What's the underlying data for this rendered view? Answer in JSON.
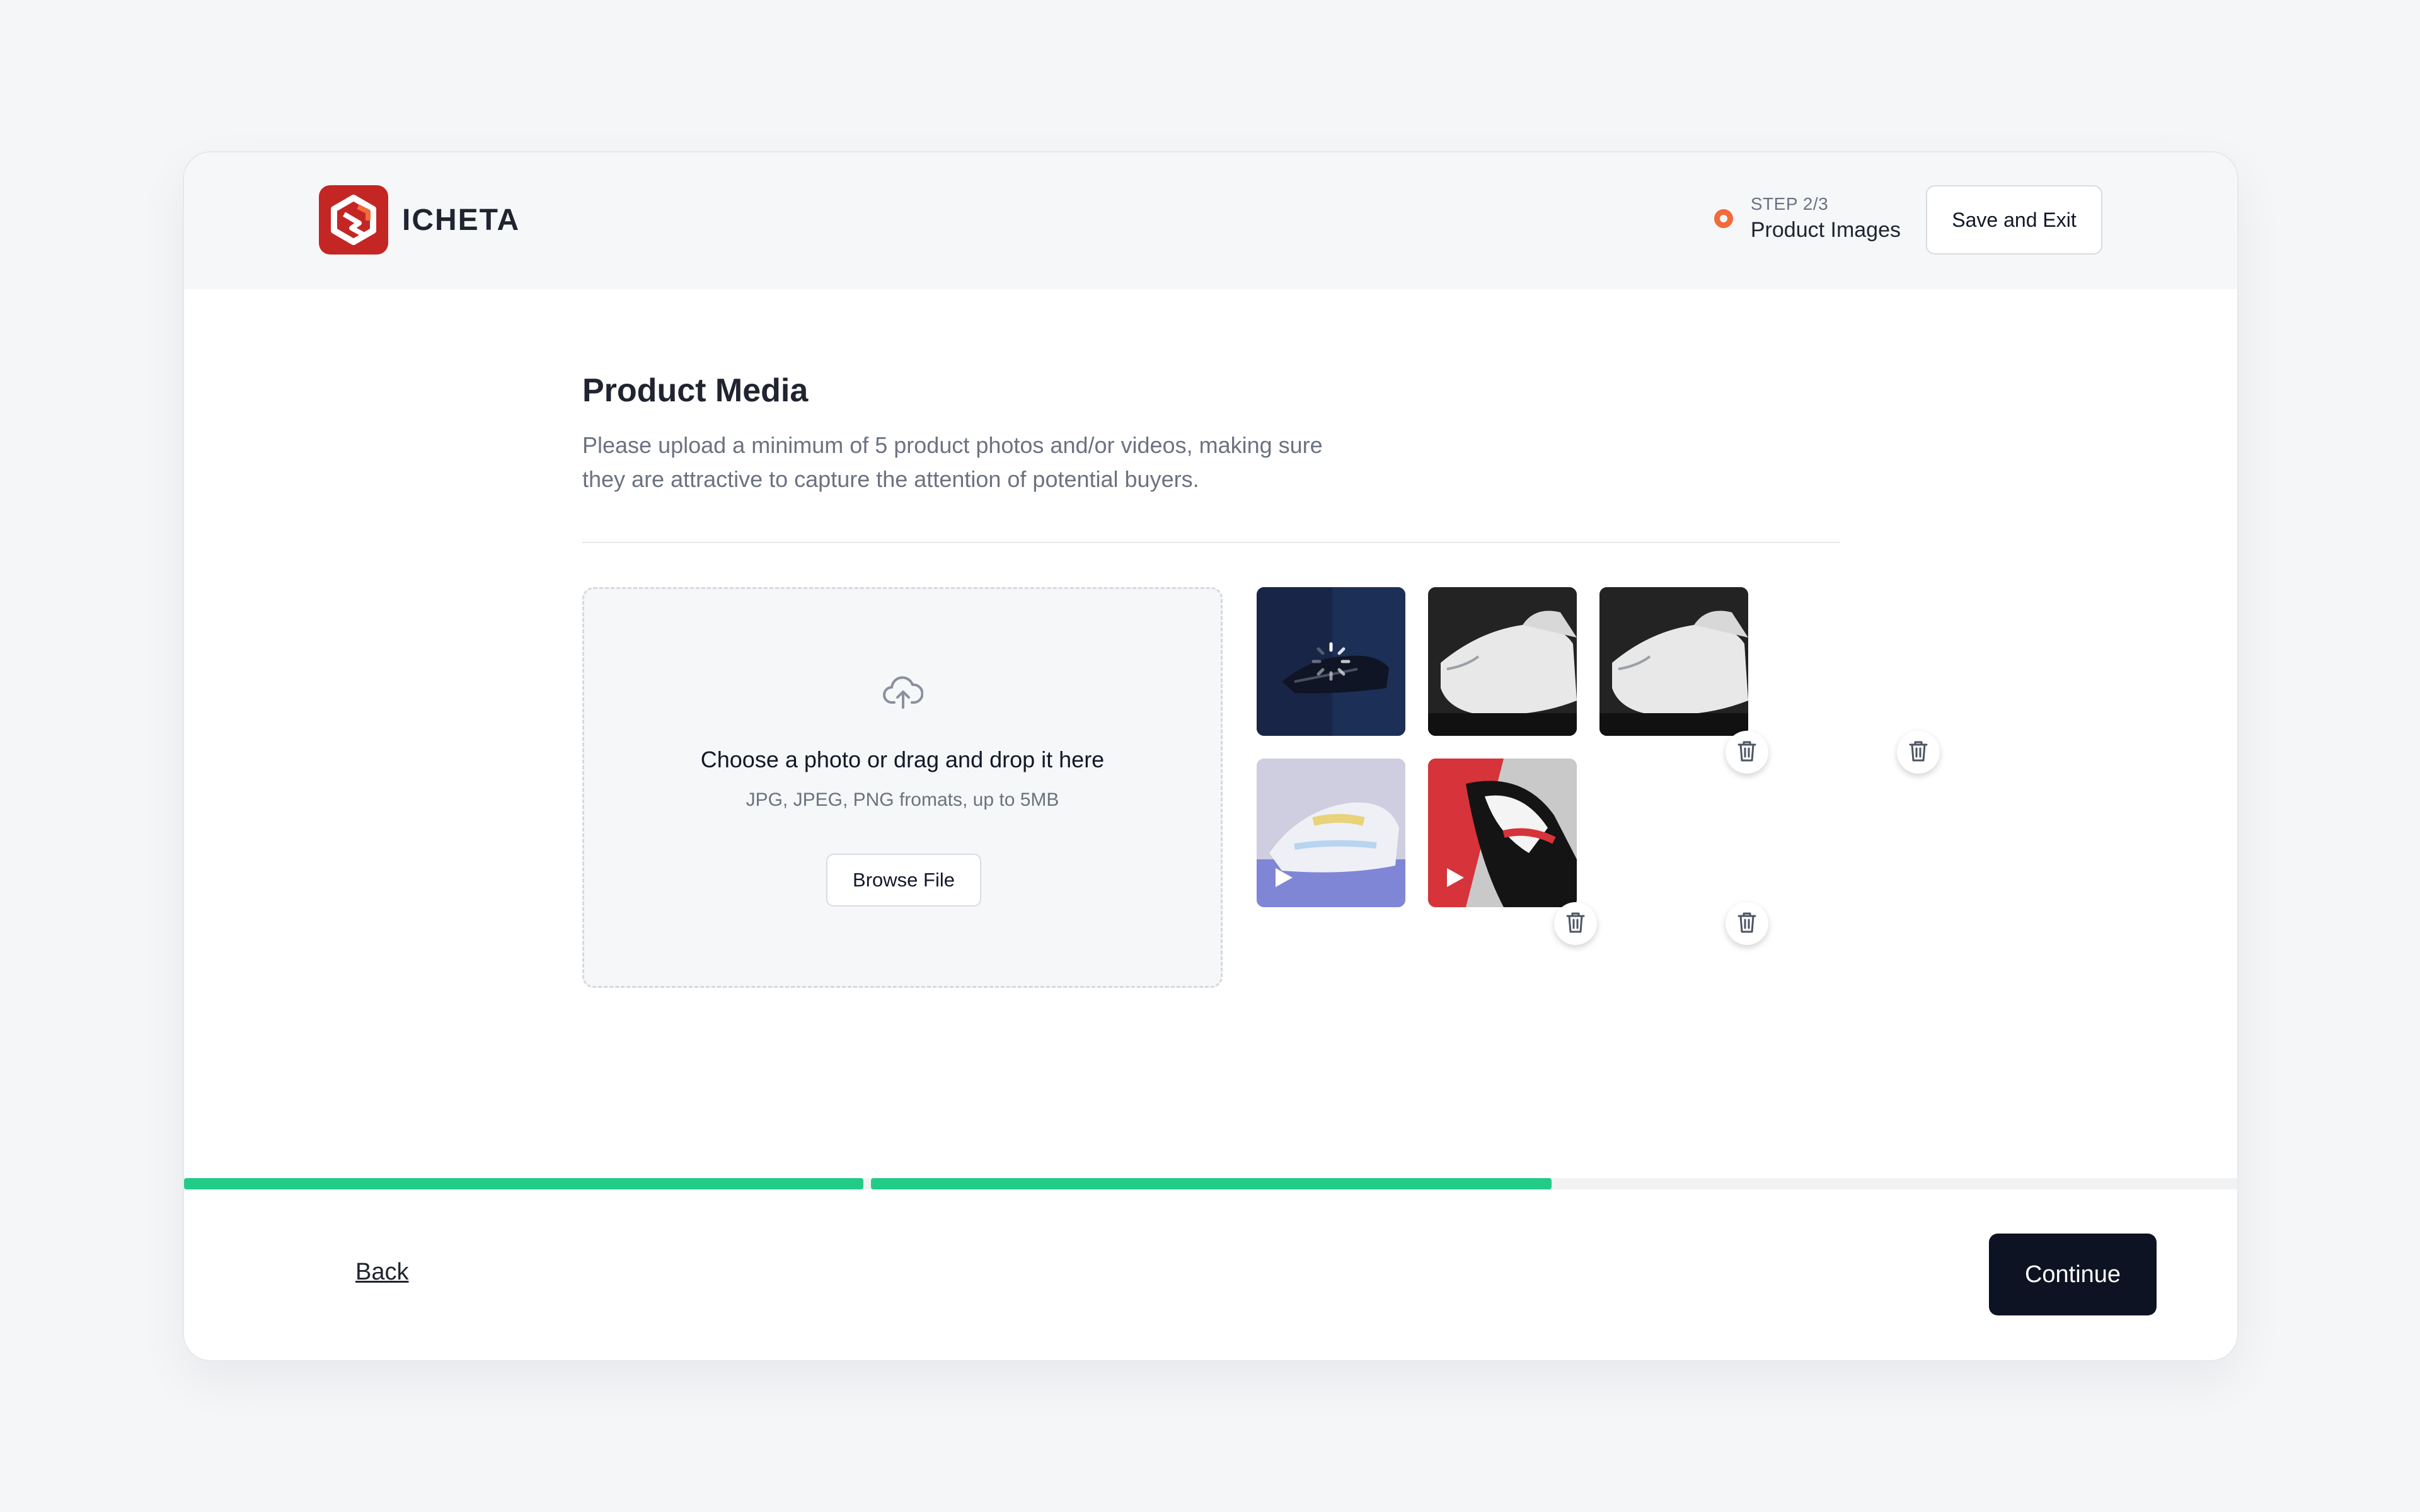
{
  "brand": {
    "name": "ICHETA",
    "logo_color": "#c42624"
  },
  "header": {
    "step_label": "STEP 2/3",
    "step_title": "Product Images",
    "save_exit_label": "Save and Exit",
    "step_dot_color": "#f26b3a"
  },
  "main": {
    "title": "Product Media",
    "subtitle": "Please upload a minimum of 5 product photos and/or videos, making sure they are attractive to capture the attention of potential buyers."
  },
  "dropzone": {
    "icon": "cloud-upload-icon",
    "title": "Choose a photo or drag and drop it here",
    "hint": "JPG, JPEG, PNG fromats, up to 5MB",
    "browse_label": "Browse File"
  },
  "media": [
    {
      "kind": "image",
      "state": "uploading",
      "icon": "loading-spinner-icon"
    },
    {
      "kind": "image",
      "state": "uploaded",
      "icon": "trash-icon"
    },
    {
      "kind": "image",
      "state": "uploaded",
      "icon": "trash-icon"
    },
    {
      "kind": "video",
      "state": "uploaded",
      "icon": "trash-icon"
    },
    {
      "kind": "video",
      "state": "uploaded",
      "icon": "trash-icon"
    }
  ],
  "progress": {
    "steps_total": 3,
    "steps_completed": 2,
    "color": "#22cc88"
  },
  "footer": {
    "back_label": "Back",
    "continue_label": "Continue",
    "continue_color": "#0d1322"
  }
}
